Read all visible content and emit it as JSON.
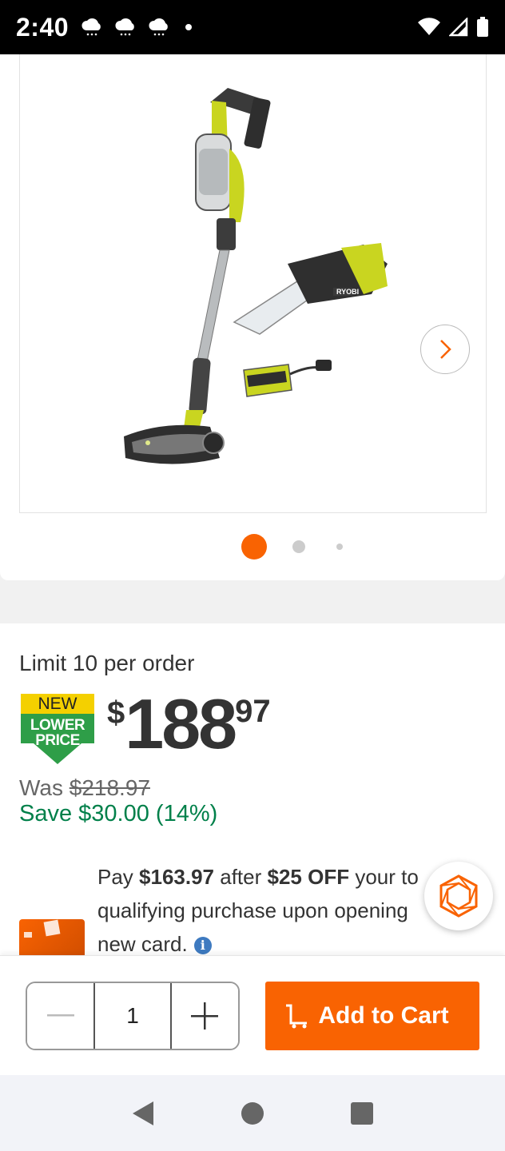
{
  "status_bar": {
    "time": "2:40"
  },
  "gallery": {
    "active_index": 0,
    "count": 3
  },
  "pricing": {
    "limit_text": "Limit 10 per order",
    "badge": {
      "line1": "NEW",
      "line2": "LOWER",
      "line3": "PRICE"
    },
    "price": {
      "currency": "$",
      "dollars": "188",
      "cents": "97"
    },
    "was_label": "Was",
    "was_price": "$218.97",
    "save_text": "Save $30.00 (14%)"
  },
  "promo": {
    "line1_pre": "Pay ",
    "line1_amount": "$163.97",
    "line1_mid": " after ",
    "line1_off": "$25 OFF",
    "line1_post": " your to",
    "line2": "qualifying purchase upon opening",
    "line3": "new card."
  },
  "cart": {
    "quantity": "1",
    "add_label": "Add to Cart"
  },
  "colors": {
    "brand_orange": "#f96302",
    "save_green": "#00804a",
    "info_blue": "#3e7ac0"
  }
}
